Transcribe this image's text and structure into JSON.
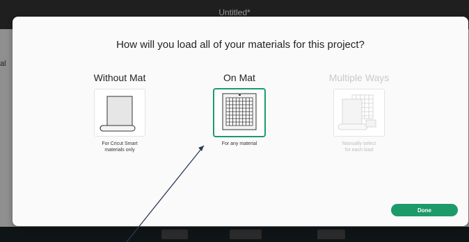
{
  "window": {
    "title": "Untitled*"
  },
  "background": {
    "left_text": "al"
  },
  "dialog": {
    "question": "How will you load all of your materials for this project?",
    "options": [
      {
        "title": "Without Mat",
        "desc_line1": "For Cricut Smart",
        "desc_line2": "materials only",
        "state": "enabled",
        "icon": "roll-icon"
      },
      {
        "title": "On Mat",
        "desc_line1": "For any material",
        "desc_line2": "",
        "state": "selected",
        "icon": "mat-grid-icon"
      },
      {
        "title": "Multiple Ways",
        "desc_line1": "Manually select",
        "desc_line2": "for each load",
        "state": "disabled",
        "icon": "multiple-ways-icon"
      }
    ],
    "done_label": "Done"
  },
  "colors": {
    "accent": "#1c9a6a",
    "dialog_bg": "#fafafa",
    "disabled_text": "#c9c9c9"
  }
}
